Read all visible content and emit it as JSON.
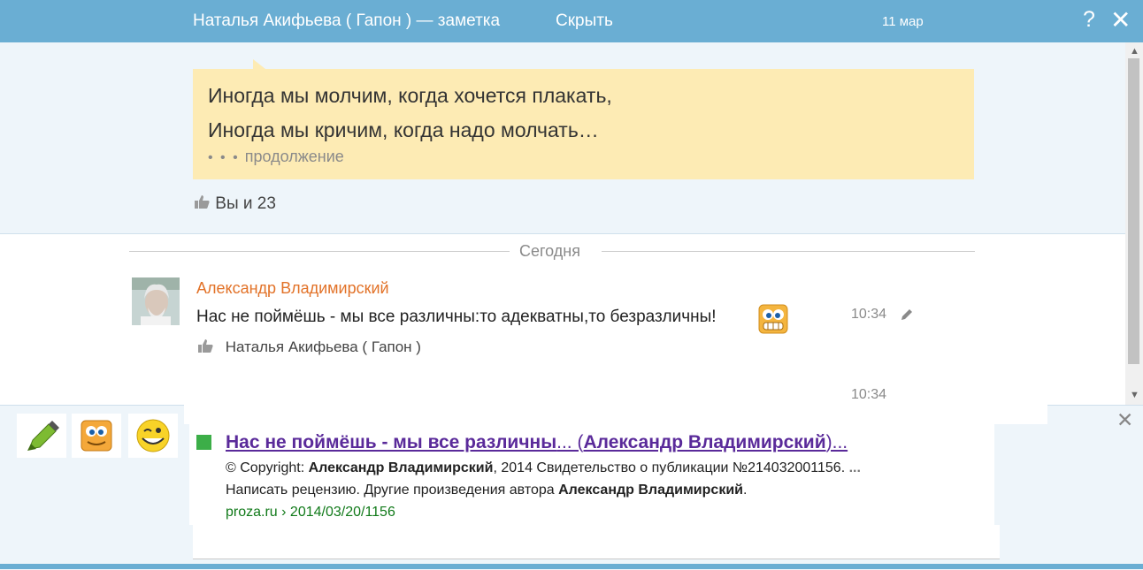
{
  "header": {
    "title": "Наталья Акифьева ( Гапон ) — заметка",
    "hide_label": "Скрыть",
    "date": "11 мар",
    "help_icon": "?",
    "close_icon": "✕"
  },
  "note": {
    "line1": "Иногда мы молчим, когда хочется плакать,",
    "line2": "Иногда мы кричим, когда надо молчать…",
    "more_dots": "• • •",
    "more_label": "продолжение",
    "likes": "Вы и 23"
  },
  "comments": {
    "date_separator": "Сегодня",
    "items": [
      {
        "author": "Александр Владимирский",
        "text": "Нас не поймёшь - мы все различны:то адекватны,то безразличны!",
        "time": "10:34",
        "liked_by": "Наталья Акифьева ( Гапон )"
      },
      {
        "time": "10:34"
      }
    ]
  },
  "toolbar": {
    "close_icon": "✕"
  },
  "search_result": {
    "title_part1": "Нас не поймёшь - мы все различны",
    "title_part2": "... (",
    "title_part3": "Александр Владимирский",
    "title_part4": ")...",
    "line1_a": "© Copyright: ",
    "line1_b": "Александр Владимирский",
    "line1_c": ", 2014 Свидетельство о публикации №214032001156. ",
    "line1_d": "...",
    "line2_a": "Написать рецензию. Другие произведения автора ",
    "line2_b": "Александр Владимирский",
    "line2_c": ".",
    "url": "proza.ru › 2014/03/20/1156"
  },
  "colors": {
    "header_bg": "#6aaed3",
    "note_bg": "#fdebb4",
    "author": "#e27228",
    "result_title": "#5a2a9a",
    "result_url": "#117a1a"
  },
  "icons": [
    "help-icon",
    "close-icon",
    "thumbs-up-icon",
    "pencil-icon",
    "marker-icon",
    "smiley-icon",
    "wink-icon"
  ]
}
